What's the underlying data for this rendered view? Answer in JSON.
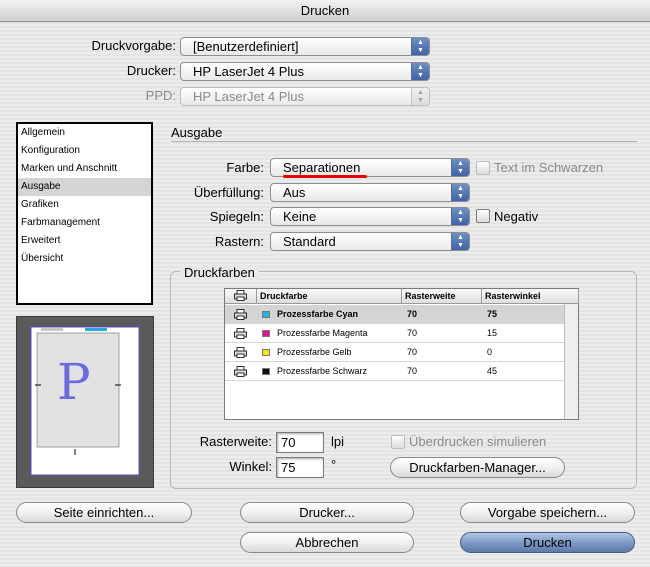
{
  "window": {
    "title": "Drucken"
  },
  "top": {
    "preset_label": "Druckvorgabe:",
    "preset_value": "[Benutzerdefiniert]",
    "printer_label": "Drucker:",
    "printer_value": "HP LaserJet 4 Plus",
    "ppd_label": "PPD:",
    "ppd_value": "HP LaserJet 4 Plus"
  },
  "sidebar": {
    "items": [
      {
        "label": "Allgemein"
      },
      {
        "label": "Konfiguration"
      },
      {
        "label": "Marken und Anschnitt"
      },
      {
        "label": "Ausgabe",
        "selected": true
      },
      {
        "label": "Grafiken"
      },
      {
        "label": "Farbmanagement"
      },
      {
        "label": "Erweitert"
      },
      {
        "label": "Übersicht"
      }
    ]
  },
  "preview": {
    "letter": "P"
  },
  "ausgabe": {
    "section_title": "Ausgabe",
    "farbe_label": "Farbe:",
    "farbe_value": "Separationen",
    "text_schwarz_label": "Text im Schwarzen",
    "ueberfuellung_label": "Überfüllung:",
    "ueberfuellung_value": "Aus",
    "spiegeln_label": "Spiegeln:",
    "spiegeln_value": "Keine",
    "negativ_label": "Negativ",
    "rastern_label": "Rastern:",
    "rastern_value": "Standard"
  },
  "druckfarben": {
    "group_title": "Druckfarben",
    "columns": {
      "druckfarbe": "Druckfarbe",
      "rasterweite": "Rasterweite",
      "rasterwinkel": "Rasterwinkel"
    },
    "rows": [
      {
        "name": "Prozessfarbe Cyan",
        "color": "#1eb4e6",
        "rasterweite": "70",
        "rasterwinkel": "75",
        "selected": true
      },
      {
        "name": "Prozessfarbe Magenta",
        "color": "#e0178c",
        "rasterweite": "70",
        "rasterwinkel": "15"
      },
      {
        "name": "Prozessfarbe Gelb",
        "color": "#f5e414",
        "rasterweite": "70",
        "rasterwinkel": "0"
      },
      {
        "name": "Prozessfarbe Schwarz",
        "color": "#111111",
        "rasterweite": "70",
        "rasterwinkel": "45"
      }
    ],
    "rasterweite_label": "Rasterweite:",
    "rasterweite_value": "70",
    "rasterweite_unit": "lpi",
    "winkel_label": "Winkel:",
    "winkel_value": "75",
    "winkel_unit": "°",
    "ueberdrucken_label": "Überdrucken simulieren",
    "manager_button": "Druckfarben-Manager..."
  },
  "buttons": {
    "seite_einrichten": "Seite einrichten...",
    "drucker": "Drucker...",
    "vorgabe_speichern": "Vorgabe speichern...",
    "abbrechen": "Abbrechen",
    "drucken": "Drucken"
  },
  "colors": {
    "accent": "#3f63a6",
    "selection": "#d4d4d4",
    "annotation_underline": "#e60000"
  }
}
